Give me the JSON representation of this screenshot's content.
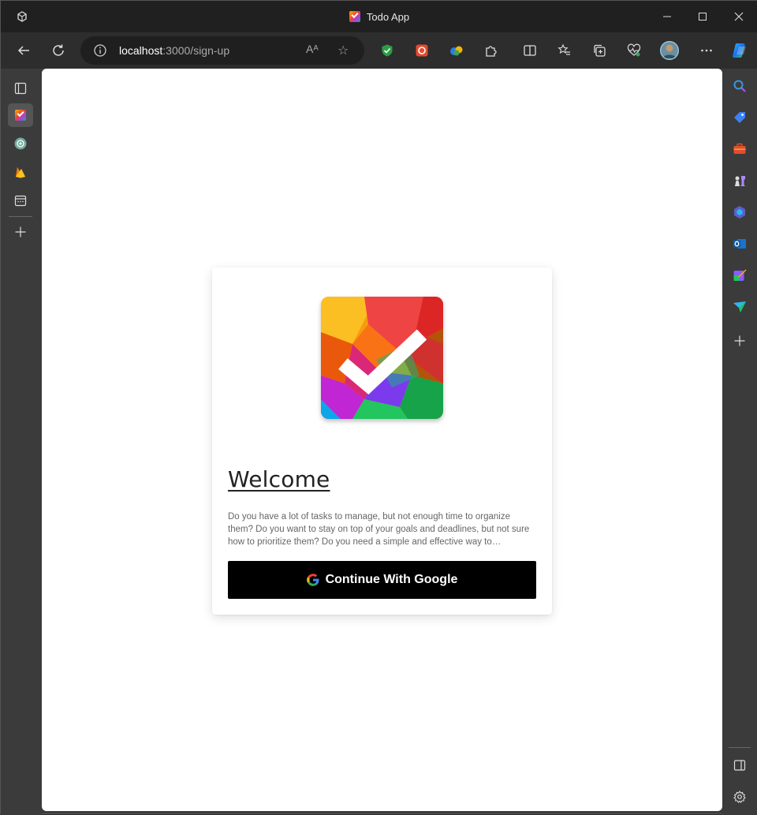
{
  "window": {
    "title": "Todo App",
    "minimize_icon": "minimize-icon",
    "maximize_icon": "maximize-icon",
    "close_icon": "close-icon"
  },
  "toolbar": {
    "url_host": "localhost",
    "url_path": ":3000/sign-up",
    "read_aloud_label": "Aᴬ"
  },
  "left_sidebar": {
    "items": [
      "tabs-icon",
      "todo-app-tab-icon",
      "chatgpt-icon",
      "firebase-icon",
      "calendar-icon",
      "add-icon"
    ]
  },
  "right_sidebar": {
    "items": [
      "search-icon",
      "shopping-tag-icon",
      "toolbox-icon",
      "chess-icon",
      "copilot-icon",
      "outlook-icon",
      "designer-icon",
      "send-icon",
      "add-icon",
      "sidebar-toggle-icon",
      "settings-icon"
    ]
  },
  "page": {
    "welcome": "Welcome",
    "description": "Do you have a lot of tasks to manage, but not enough time to organize them? Do you want to stay on top of your goals and deadlines, but not sure how to prioritize them? Do you need a simple and effective way to…",
    "google_button": "Continue With Google"
  },
  "colors": {
    "button_bg": "#000000",
    "page_bg": "#ffffff",
    "chrome_bg": "#3b3b3b"
  }
}
